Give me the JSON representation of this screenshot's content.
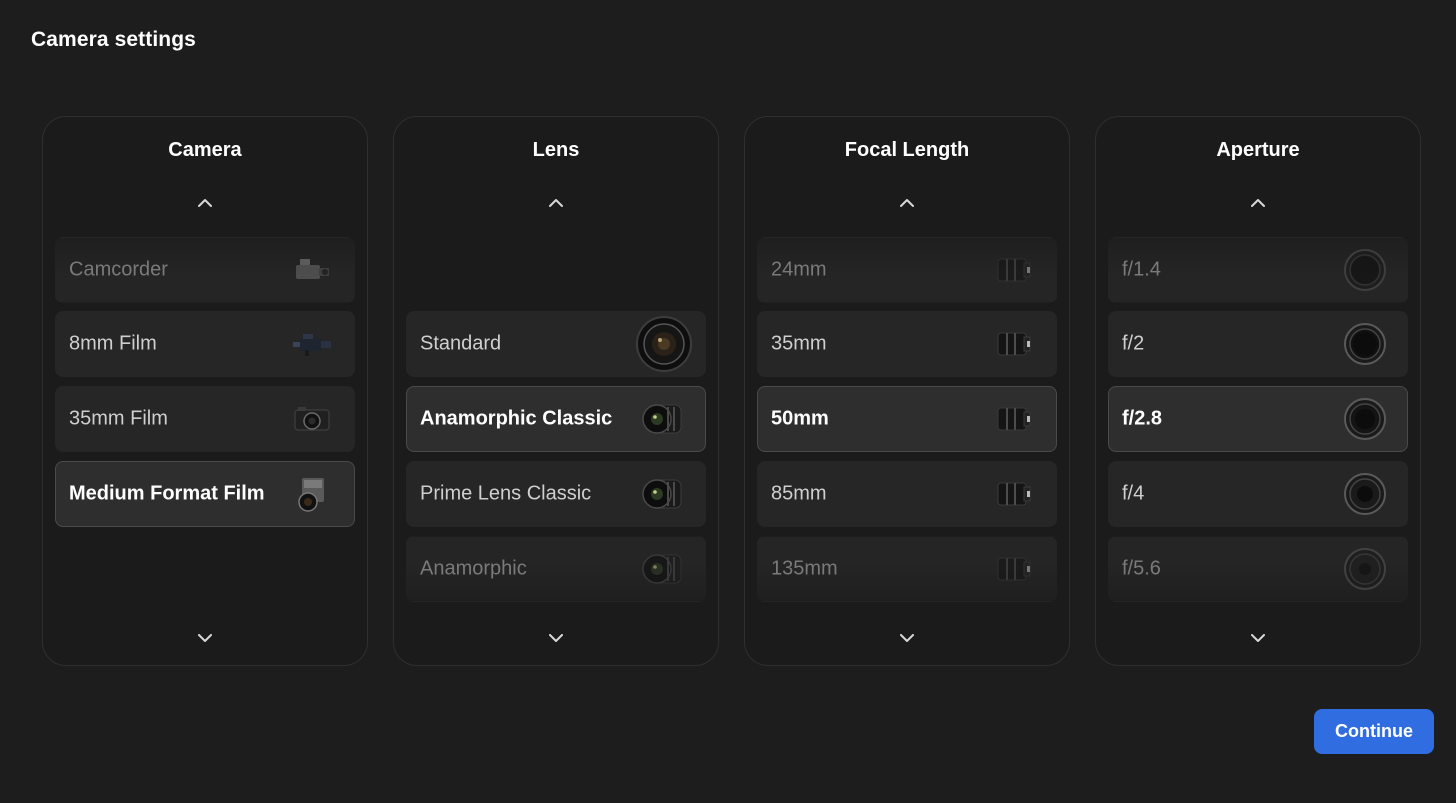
{
  "dialog": {
    "title": "Camera settings"
  },
  "columns": [
    {
      "title": "Camera",
      "items": [
        {
          "label": "Camcorder",
          "icon": "camcorder-icon",
          "state": "dim"
        },
        {
          "label": "8mm Film",
          "icon": "film-camera-icon",
          "state": "normal"
        },
        {
          "label": "35mm Film",
          "icon": "rangefinder-camera-icon",
          "state": "normal"
        },
        {
          "label": "Medium Format Film",
          "icon": "medium-format-camera-icon",
          "state": "selected"
        }
      ]
    },
    {
      "title": "Lens",
      "items": [
        {
          "label": "Standard",
          "icon": "standard-lens-icon",
          "state": "normal"
        },
        {
          "label": "Anamorphic Classic",
          "icon": "cine-lens-icon",
          "state": "selected"
        },
        {
          "label": "Prime Lens Classic",
          "icon": "cine-lens-icon",
          "state": "normal"
        },
        {
          "label": "Anamorphic",
          "icon": "cine-lens-icon",
          "state": "dim"
        }
      ]
    },
    {
      "title": "Focal Length",
      "items": [
        {
          "label": "24mm",
          "icon": "lens-side-icon",
          "state": "dim"
        },
        {
          "label": "35mm",
          "icon": "lens-side-icon",
          "state": "normal"
        },
        {
          "label": "50mm",
          "icon": "lens-side-icon",
          "state": "selected"
        },
        {
          "label": "85mm",
          "icon": "lens-side-icon",
          "state": "normal"
        },
        {
          "label": "135mm",
          "icon": "lens-side-icon",
          "state": "dim"
        }
      ]
    },
    {
      "title": "Aperture",
      "items": [
        {
          "label": "f/1.4",
          "icon": "aperture-ring-icon",
          "state": "dim"
        },
        {
          "label": "f/2",
          "icon": "aperture-ring-icon",
          "state": "normal"
        },
        {
          "label": "f/2.8",
          "icon": "aperture-ring-icon",
          "state": "selected"
        },
        {
          "label": "f/4",
          "icon": "aperture-ring-icon",
          "state": "normal"
        },
        {
          "label": "f/5.6",
          "icon": "aperture-ring-icon",
          "state": "dim"
        }
      ]
    }
  ],
  "actions": {
    "continue_label": "Continue"
  },
  "colors": {
    "accent": "#2f6de1",
    "background": "#1d1d1d",
    "card": "#262626",
    "selected_border": "#4a4a4a"
  }
}
